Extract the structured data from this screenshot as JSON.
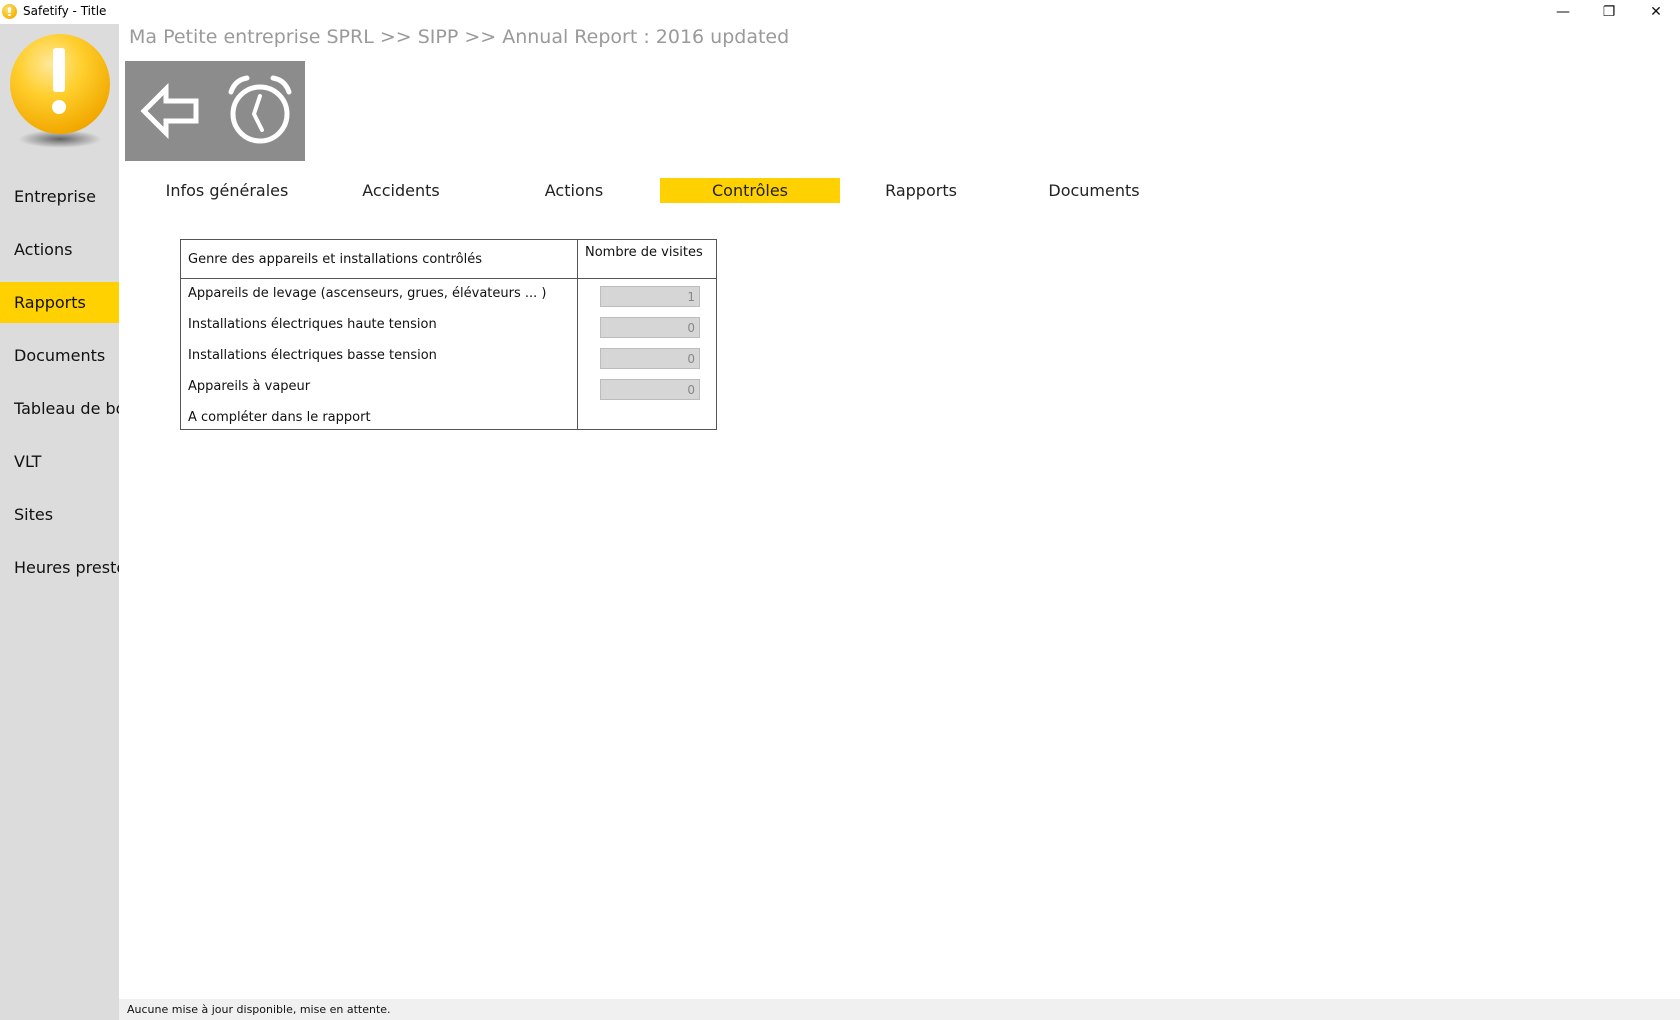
{
  "window": {
    "title": "Safetify - Title",
    "minimize_glyph": "—",
    "maximize_glyph": "❐",
    "close_glyph": "✕"
  },
  "sidebar": {
    "items": [
      {
        "label": "Entreprise"
      },
      {
        "label": "Actions"
      },
      {
        "label": "Rapports",
        "active": true
      },
      {
        "label": "Documents"
      },
      {
        "label": "Tableau de bord"
      },
      {
        "label": "VLT"
      },
      {
        "label": "Sites"
      },
      {
        "label": "Heures prestées"
      }
    ]
  },
  "breadcrumb": "Ma Petite entreprise SPRL  >>  SIPP  >>  Annual Report : 2016 updated",
  "toolbar": {
    "back_icon": "back-arrow-icon",
    "timer_icon": "stopwatch-icon"
  },
  "tabs": [
    {
      "label": "Infos générales"
    },
    {
      "label": "Accidents"
    },
    {
      "label": "Actions"
    },
    {
      "label": "Contrôles",
      "active": true
    },
    {
      "label": "Rapports"
    },
    {
      "label": "Documents"
    }
  ],
  "table": {
    "header_left": "Genre des appareils et installations contrôlés",
    "header_right": "Nombre de visites",
    "rows": [
      {
        "label": "Appareils de levage (ascenseurs, grues, élévateurs ... )",
        "value": "1"
      },
      {
        "label": "Installations électriques haute tension",
        "value": "0"
      },
      {
        "label": "Installations électriques basse tension",
        "value": "0"
      },
      {
        "label": "Appareils à vapeur",
        "value": "0"
      },
      {
        "label": "A compléter dans le rapport"
      }
    ]
  },
  "status": {
    "text": "Aucune mise à jour disponible, mise en attente."
  },
  "colors": {
    "accent": "#ffd100",
    "sidebar_bg": "#dcdcdc",
    "toolbar_bg": "#8c8c8c",
    "breadcrumb_text": "#9a9a9a"
  }
}
